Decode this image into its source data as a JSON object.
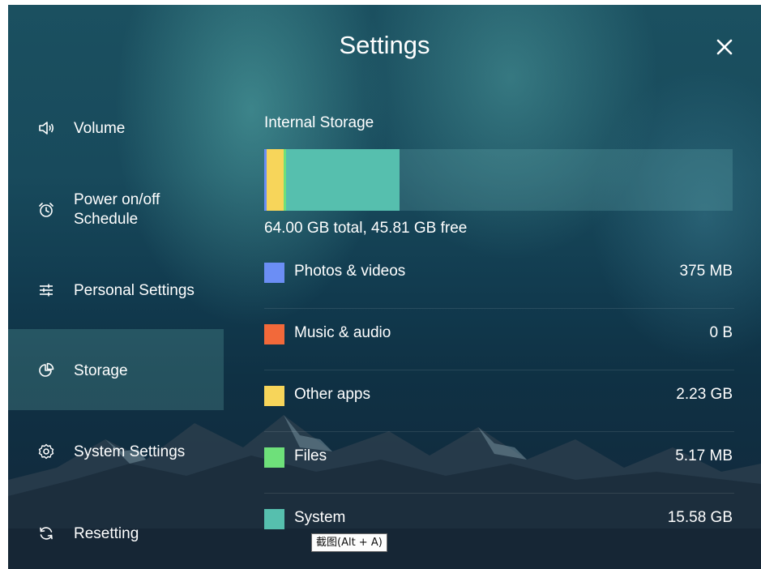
{
  "header": {
    "title": "Settings",
    "close_icon": "close-icon"
  },
  "sidebar": {
    "items": [
      {
        "label": "Volume",
        "icon": "speaker-icon"
      },
      {
        "label": "Power on/off",
        "label2": "Schedule",
        "icon": "alarm-clock-icon"
      },
      {
        "label": "Personal Settings",
        "icon": "sliders-icon"
      },
      {
        "label": "Storage",
        "icon": "pie-chart-icon",
        "active": true
      },
      {
        "label": "System Settings",
        "icon": "gear-icon"
      },
      {
        "label": "Resetting",
        "icon": "refresh-icon"
      }
    ]
  },
  "storage": {
    "title": "Internal Storage",
    "summary": "64.00 GB total, 45.81 GB free",
    "total_gb": 64.0,
    "free_gb": 45.81,
    "categories": [
      {
        "label": "Photos & videos",
        "size": "375 MB",
        "size_gb": 0.375,
        "color": "#6b8ef5"
      },
      {
        "label": "Music & audio",
        "size": "0 B",
        "size_gb": 0,
        "color": "#f2693a"
      },
      {
        "label": "Other apps",
        "size": "2.23 GB",
        "size_gb": 2.23,
        "color": "#f7d55a"
      },
      {
        "label": "Files",
        "size": "5.17 MB",
        "size_gb": 0.00517,
        "color": "#6ee07a"
      },
      {
        "label": "System",
        "size": "15.58 GB",
        "size_gb": 15.58,
        "color": "#56bfae"
      }
    ]
  },
  "tooltip": {
    "text": "截图(Alt + A)"
  }
}
